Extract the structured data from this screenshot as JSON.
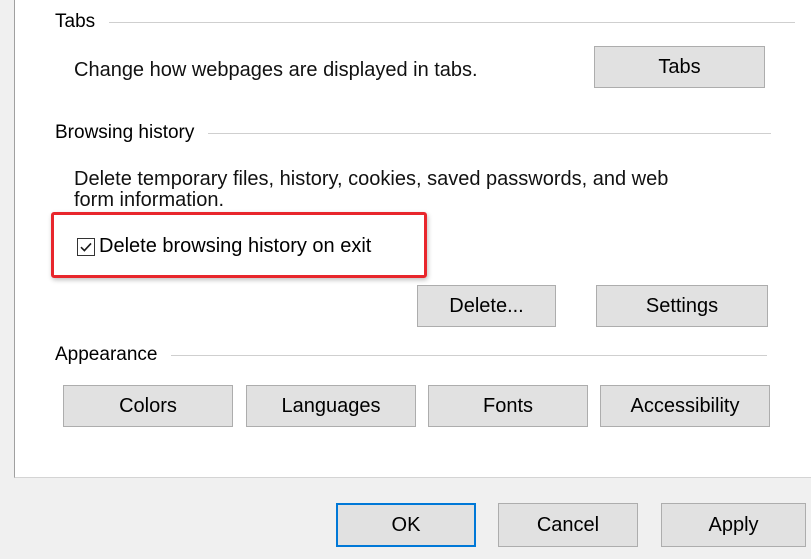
{
  "sections": {
    "tabs": {
      "title": "Tabs",
      "description": "Change how webpages are displayed in tabs.",
      "button_label": "Tabs"
    },
    "browsing_history": {
      "title": "Browsing history",
      "description_line1": "Delete temporary files, history, cookies, saved passwords, and web",
      "description_line2": "form information.",
      "checkbox_label": "Delete browsing history on exit",
      "checkbox_checked": true,
      "delete_label": "Delete...",
      "settings_label": "Settings"
    },
    "appearance": {
      "title": "Appearance",
      "buttons": [
        "Colors",
        "Languages",
        "Fonts",
        "Accessibility"
      ]
    }
  },
  "footer": {
    "ok_label": "OK",
    "cancel_label": "Cancel",
    "apply_label": "Apply"
  },
  "colors": {
    "highlight": "#e8262c",
    "default_button_border": "#0078d7",
    "button_face": "#e1e1e1"
  },
  "icons": {
    "checkbox": "checkmark-icon"
  }
}
